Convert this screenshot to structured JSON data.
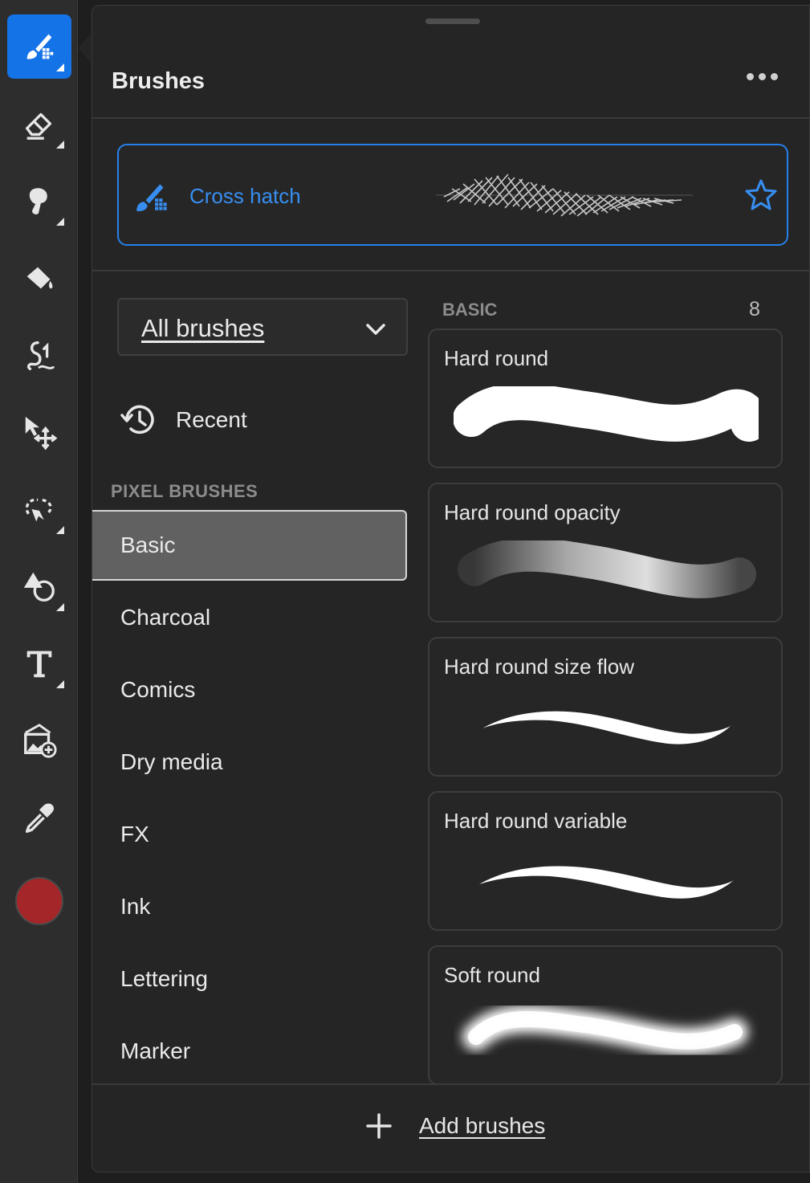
{
  "toolbar": {
    "tools": [
      {
        "name": "brush-tool",
        "icon": "brush-icon",
        "active": true,
        "has_submenu": true
      },
      {
        "name": "eraser-tool",
        "icon": "eraser-icon",
        "active": false,
        "has_submenu": true
      },
      {
        "name": "smudge-tool",
        "icon": "smudge-icon",
        "active": false,
        "has_submenu": true
      },
      {
        "name": "fill-tool",
        "icon": "paint-bucket-icon",
        "active": false,
        "has_submenu": false
      },
      {
        "name": "liquify-tool",
        "icon": "liquify-icon",
        "active": false,
        "has_submenu": false
      },
      {
        "name": "transform-tool",
        "icon": "move-transform-icon",
        "active": false,
        "has_submenu": false
      },
      {
        "name": "lasso-tool",
        "icon": "lasso-icon",
        "active": false,
        "has_submenu": true
      },
      {
        "name": "shape-tool",
        "icon": "shape-icon",
        "active": false,
        "has_submenu": true
      },
      {
        "name": "type-tool",
        "icon": "type-icon",
        "active": false,
        "has_submenu": true
      },
      {
        "name": "place-image-tool",
        "icon": "place-image-icon",
        "active": false,
        "has_submenu": false
      },
      {
        "name": "eyedropper-tool",
        "icon": "eyedropper-icon",
        "active": false,
        "has_submenu": false
      }
    ],
    "current_color": "#a52628",
    "accent": "#1473e6"
  },
  "panel": {
    "title": "Brushes",
    "more_icon": "more-icon",
    "current_brush": {
      "label": "Cross hatch",
      "favorite_icon": "star-icon"
    },
    "filter": {
      "selected": "All brushes"
    },
    "recent_label": "Recent",
    "section_heading": "PIXEL BRUSHES",
    "categories": [
      "Basic",
      "Charcoal",
      "Comics",
      "Dry media",
      "FX",
      "Ink",
      "Lettering",
      "Marker"
    ],
    "selected_category": "Basic",
    "list": {
      "heading": "BASIC",
      "count": "8",
      "brushes": [
        {
          "label": "Hard round",
          "style": "hard"
        },
        {
          "label": "Hard round opacity",
          "style": "opacity"
        },
        {
          "label": "Hard round size flow",
          "style": "taper"
        },
        {
          "label": "Hard round variable",
          "style": "taper"
        },
        {
          "label": "Soft round",
          "style": "soft"
        }
      ]
    },
    "footer": {
      "add_label": "Add brushes"
    }
  }
}
